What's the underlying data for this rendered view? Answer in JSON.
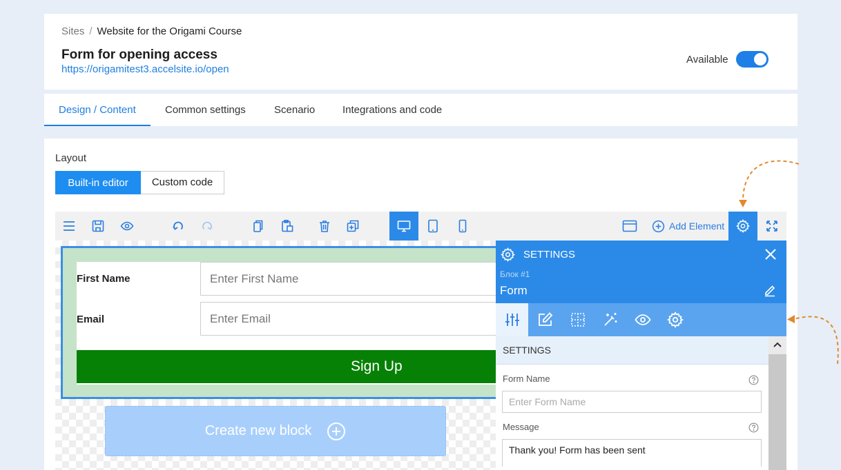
{
  "header": {
    "breadcrumb_root": "Sites",
    "breadcrumb_sep": "/",
    "breadcrumb_current": "Website for the Origami Course",
    "title": "Form for opening access",
    "url": "https://origamitest3.accelsite.io/open",
    "available_label": "Available",
    "available": true
  },
  "tabs": [
    {
      "label": "Design / Content",
      "active": true
    },
    {
      "label": "Common settings"
    },
    {
      "label": "Scenario"
    },
    {
      "label": "Integrations and code"
    }
  ],
  "layout": {
    "label": "Layout",
    "builtin_label": "Built-in editor",
    "custom_label": "Custom code"
  },
  "toolbar": {
    "icons": [
      "menu-icon",
      "save-icon",
      "preview-icon",
      "undo-icon",
      "redo-icon",
      "copy-icon",
      "paste-icon",
      "delete-icon",
      "duplicate-icon",
      "desktop-icon",
      "tablet-icon",
      "mobile-icon",
      "window-icon",
      "gear-icon",
      "fullscreen-icon"
    ],
    "add_element_label": "Add Element"
  },
  "canvas": {
    "first_name_label": "First Name",
    "first_name_placeholder": "Enter First Name",
    "email_label": "Email",
    "email_placeholder": "Enter Email",
    "signup_label": "Sign Up",
    "create_block_label": "Create new block"
  },
  "settings": {
    "title": "SETTINGS",
    "block_sub": "Блок #1",
    "block_name": "Form",
    "tab_icons": [
      "sliders-icon",
      "edit-icon",
      "grid-icon",
      "magic-wand-icon",
      "eye-icon",
      "gear-icon"
    ],
    "section_title": "SETTINGS",
    "form_name_label": "Form Name",
    "form_name_placeholder": "Enter Form Name",
    "message_label": "Message",
    "message_value": "Thank you! Form has been sent"
  },
  "colors": {
    "accent": "#2b8ae8",
    "signup_green": "#078006",
    "form_bg": "#c5e3c8",
    "annotation_orange": "#e08a2e"
  }
}
